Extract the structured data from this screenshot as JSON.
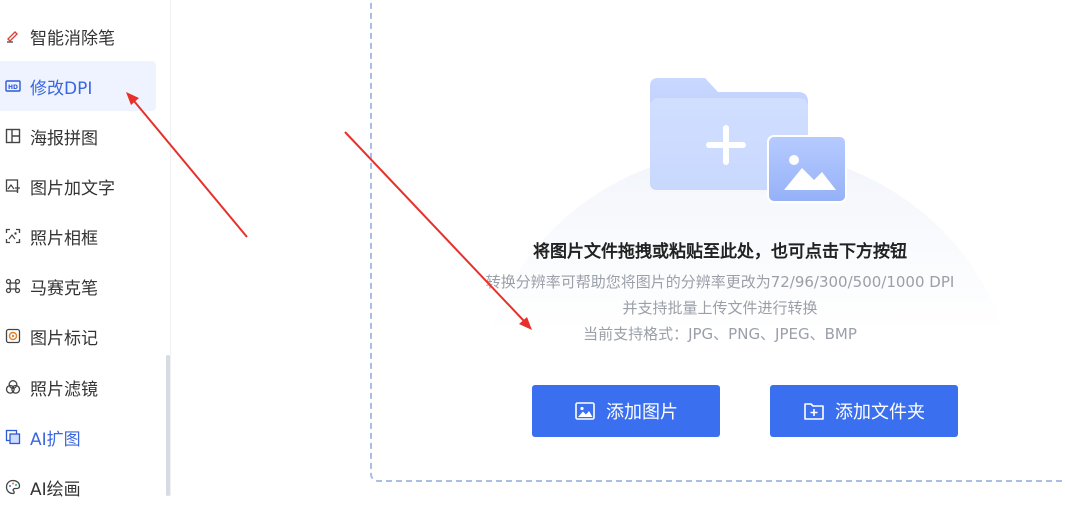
{
  "sidebar": {
    "items": [
      {
        "label": "智能消除笔",
        "icon": "eraser-pen-icon"
      },
      {
        "label": "修改DPI",
        "icon": "hd-icon",
        "active": true
      },
      {
        "label": "海报拼图",
        "icon": "collage-icon"
      },
      {
        "label": "图片加文字",
        "icon": "image-text-icon"
      },
      {
        "label": "照片相框",
        "icon": "photo-frame-icon"
      },
      {
        "label": "马赛克笔",
        "icon": "mosaic-icon"
      },
      {
        "label": "图片标记",
        "icon": "mark-icon"
      },
      {
        "label": "照片滤镜",
        "icon": "filter-icon"
      },
      {
        "label": "AI扩图",
        "icon": "ai-expand-icon"
      },
      {
        "label": "AI绘画",
        "icon": "palette-icon"
      }
    ]
  },
  "dropzone": {
    "title": "将图片文件拖拽或粘贴至此处，也可点击下方按钮",
    "line1": "转换分辨率可帮助您将图片的分辨率更改为72/96/300/500/1000 DPI",
    "line2": "并支持批量上传文件进行转换",
    "line3": "当前支持格式：JPG、PNG、JPEG、BMP"
  },
  "buttons": {
    "add_image": "添加图片",
    "add_folder": "添加文件夹"
  },
  "colors": {
    "accent": "#3a6ff0",
    "active_bg": "#eef3ff",
    "arrow": "#e8302b"
  }
}
